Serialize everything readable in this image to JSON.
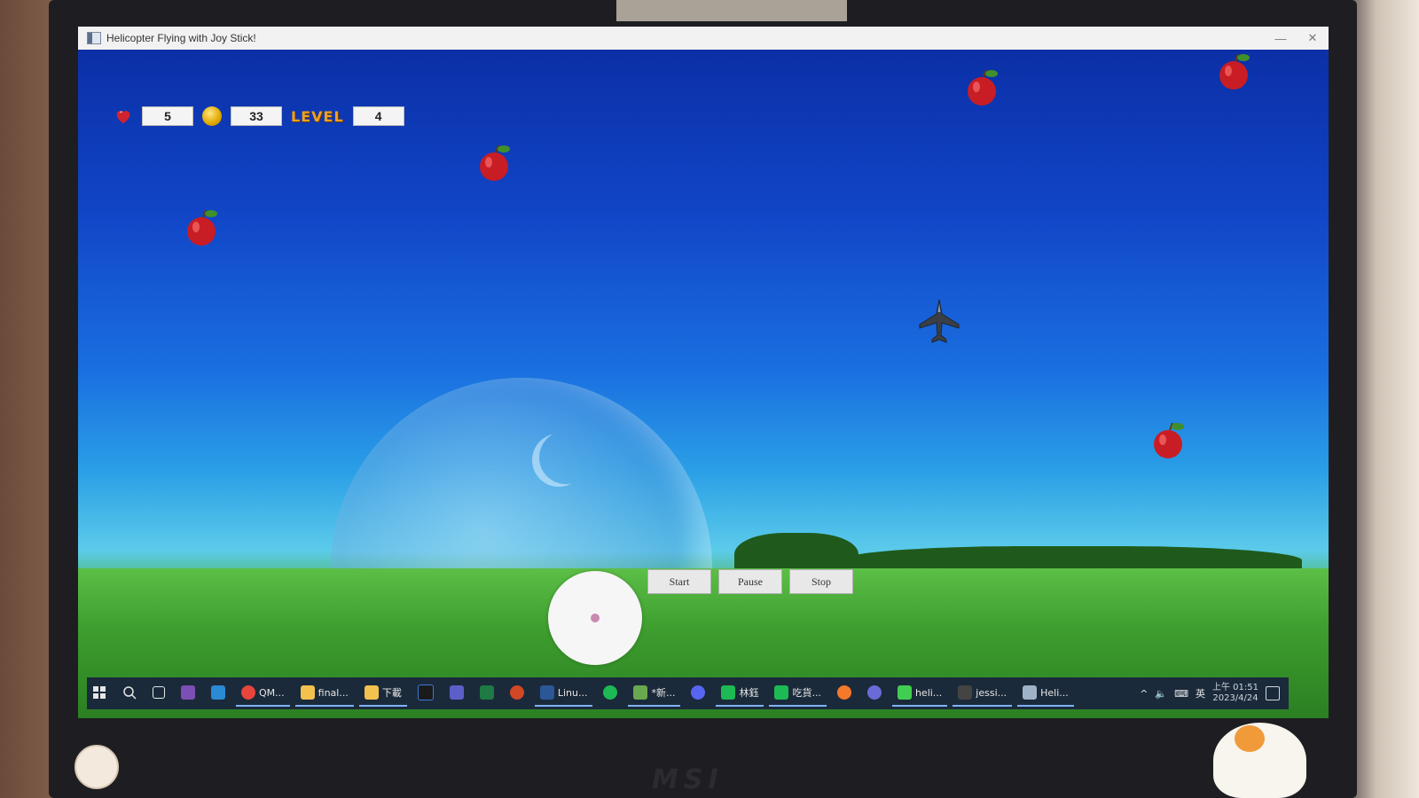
{
  "window": {
    "title": "Helicopter Flying with Joy Stick!",
    "minimize": "—",
    "close": "✕"
  },
  "hud": {
    "lives": "5",
    "coins": "33",
    "level_label": "LEVEL",
    "level": "4"
  },
  "controls": {
    "start": "Start",
    "pause": "Pause",
    "stop": "Stop"
  },
  "taskbar": {
    "items": [
      {
        "label": "QM...",
        "icon": "chrome-icon",
        "color": "#e8453c"
      },
      {
        "label": "final...",
        "icon": "folder-icon",
        "color": "#f2c14e"
      },
      {
        "label": "下載",
        "icon": "folder-icon",
        "color": "#f2c14e"
      },
      {
        "label": "Linu...",
        "icon": "word-icon",
        "color": "#2b5797"
      },
      {
        "label": "*新...",
        "icon": "notepad-icon",
        "color": "#6aa84f"
      },
      {
        "label": "林鈺",
        "icon": "contact-icon",
        "color": "#1db954"
      },
      {
        "label": "吃貨...",
        "icon": "group-icon",
        "color": "#1db954"
      },
      {
        "label": "heli...",
        "icon": "qt-icon",
        "color": "#41cd52"
      },
      {
        "label": "jessi...",
        "icon": "terminal-icon",
        "color": "#444444"
      },
      {
        "label": "Heli...",
        "icon": "app-window-icon",
        "color": "#9fb3c8"
      }
    ],
    "ime": "英",
    "time": "上午 01:51",
    "date": "2023/4/24"
  },
  "colors": {
    "sky_top": "#0b2fa6",
    "grass": "#3c9a35",
    "hud_level": "#f0a020"
  }
}
